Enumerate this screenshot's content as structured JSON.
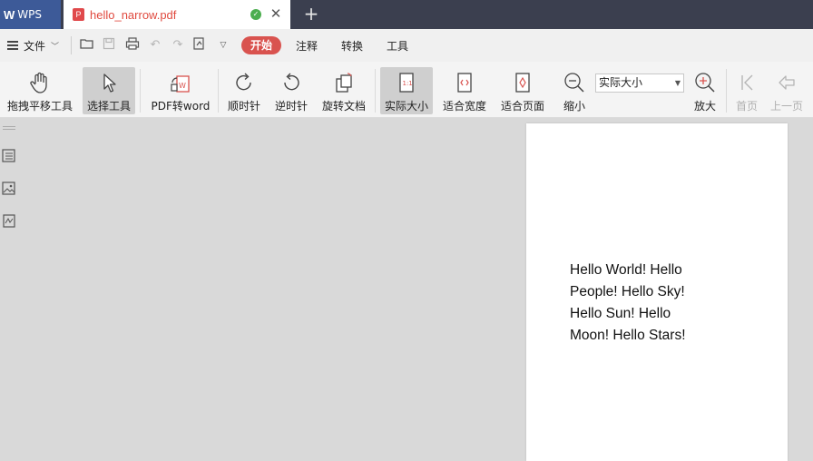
{
  "title_bar": {
    "app_tab_label": "WPS",
    "document_tab_name": "hello_narrow.pdf",
    "new_tab_symbol": "+"
  },
  "menu_bar": {
    "file_label": "文件",
    "start_tab": "开始",
    "tabs": [
      "注释",
      "转换",
      "工具"
    ]
  },
  "toolbar": {
    "pan_tool": "拖拽平移工具",
    "select_tool": "选择工具",
    "pdf_to_word": "PDF转word",
    "rotate_clockwise": "顺时针",
    "rotate_counterclockwise": "逆时针",
    "rotate_document": "旋转文档",
    "actual_size": "实际大小",
    "fit_width": "适合宽度",
    "fit_page": "适合页面",
    "zoom_out": "缩小",
    "zoom_select_value": "实际大小",
    "zoom_in": "放大",
    "first_page": "首页",
    "previous_page": "上一页"
  },
  "document": {
    "lines": [
      "Hello World! Hello",
      "People! Hello Sky!",
      "Hello Sun! Hello",
      "Moon! Hello Stars!"
    ]
  },
  "colors": {
    "title_bar_bg": "#3b3f4f",
    "wps_tab_bg": "#3d5a98",
    "accent_red": "#d9534f",
    "canvas_bg": "#d9d9d9"
  }
}
